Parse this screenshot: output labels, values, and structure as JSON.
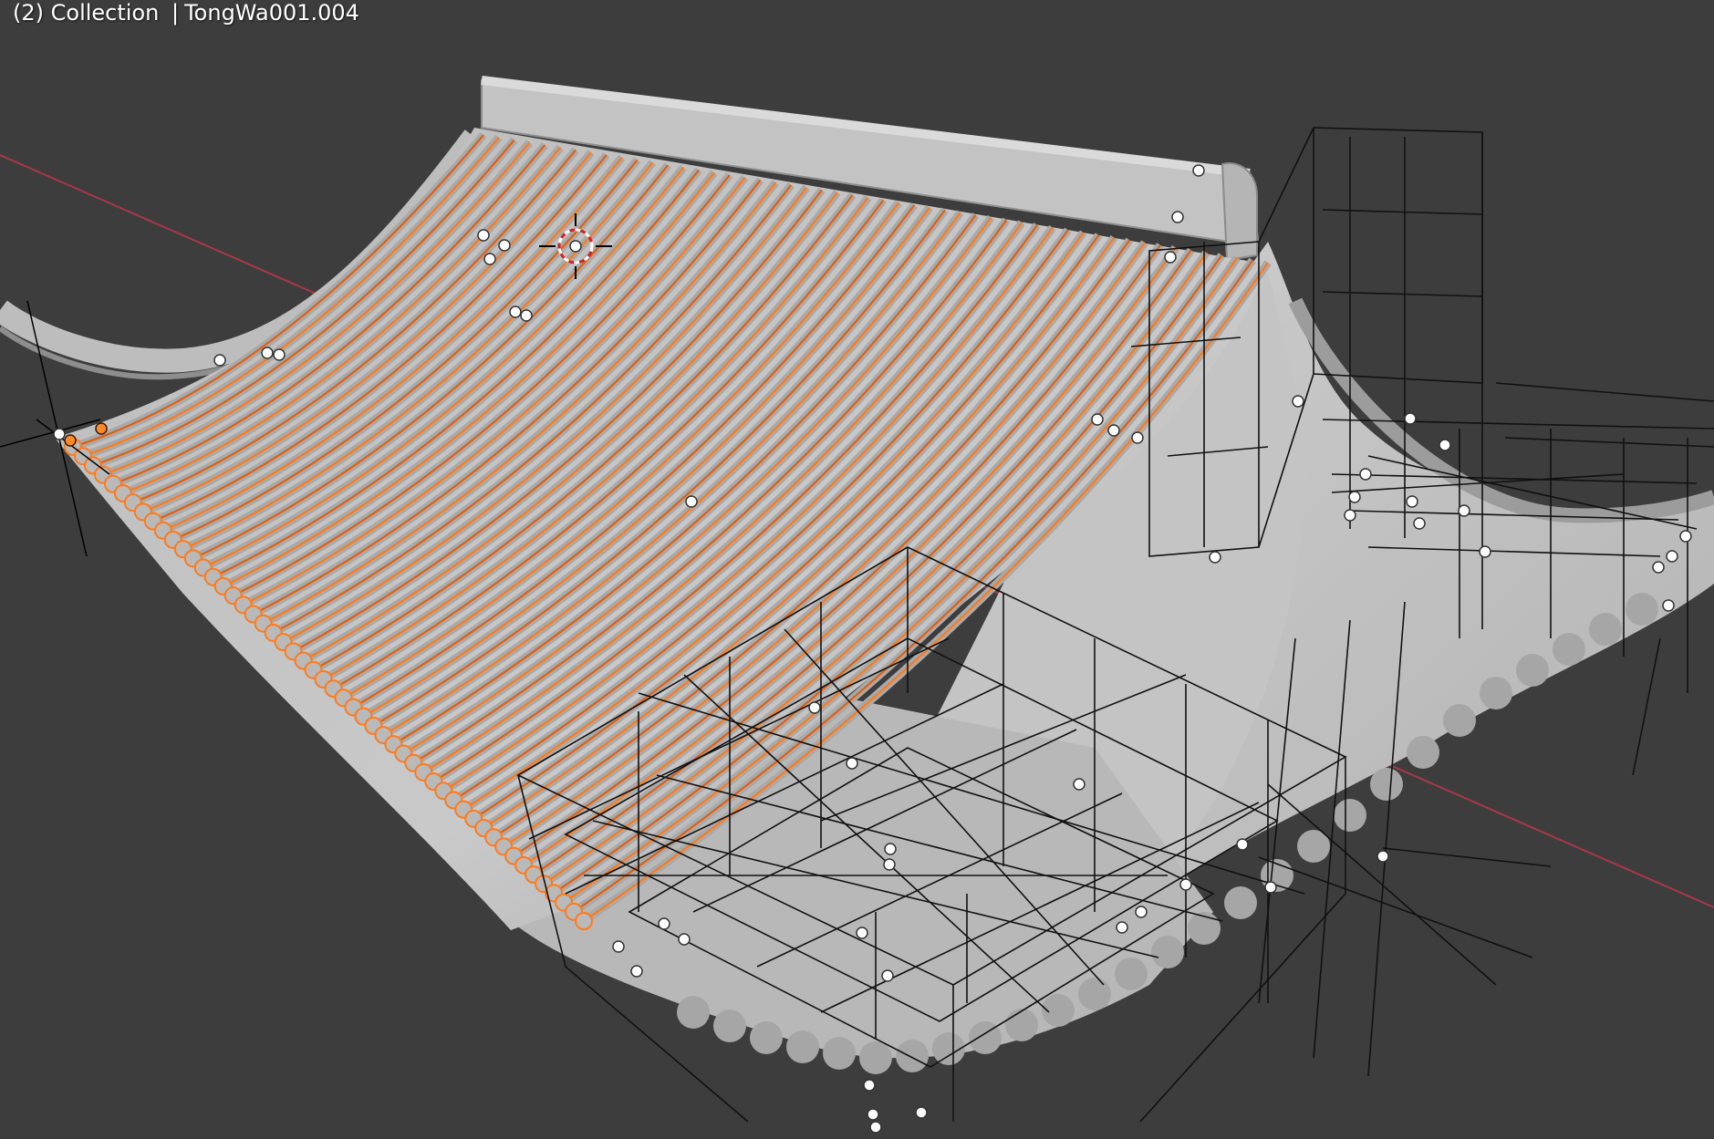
{
  "viewport": {
    "frame": "(2)",
    "collection": "Collection",
    "separator": "|",
    "object": "TongWa001.004"
  },
  "colors": {
    "background": "#3d3d3d",
    "mesh": "#c8c8c8",
    "mesh_shadow": "#8e8e8e",
    "selection": "#ff7a1a",
    "selection_dark": "#e06010",
    "wire": "#000000",
    "axis_x": "#b03040",
    "empty": "#ffffff"
  },
  "icons": {
    "origin": "3d-cursor-icon"
  }
}
